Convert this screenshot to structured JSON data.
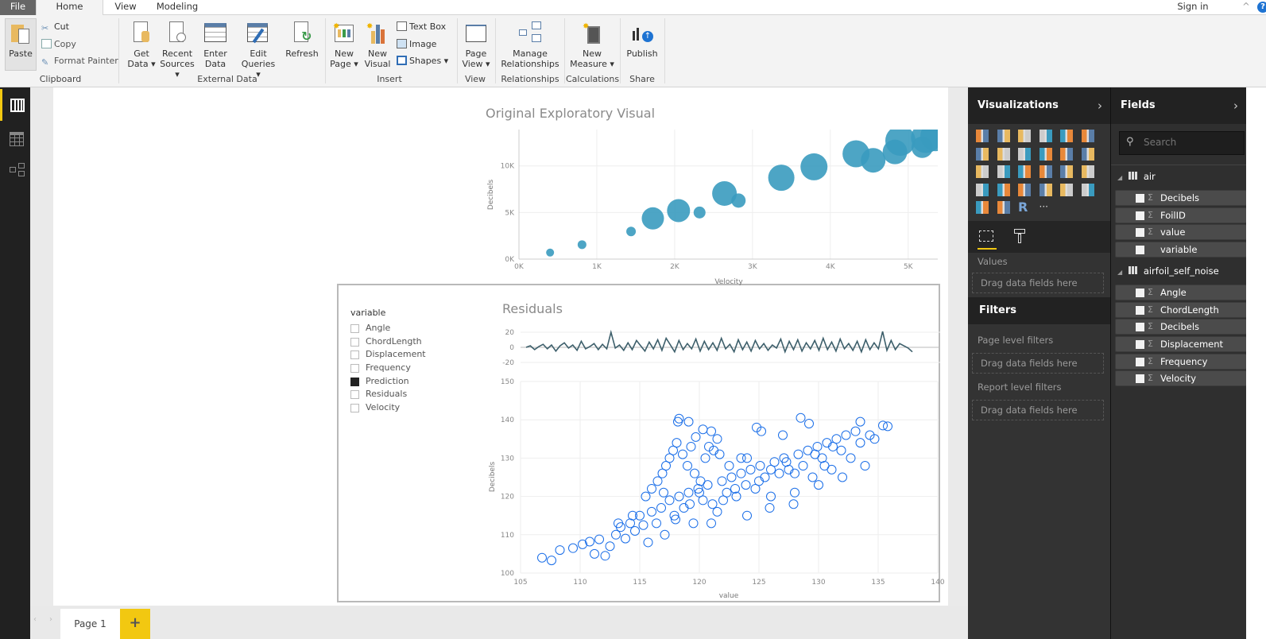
{
  "tabs": {
    "file": "File",
    "home": "Home",
    "view": "View",
    "modeling": "Modeling",
    "sign_in": "Sign in"
  },
  "ribbon": {
    "clipboard": {
      "paste": "Paste",
      "cut": "Cut",
      "copy": "Copy",
      "format_painter": "Format Painter",
      "group": "Clipboard"
    },
    "external_data": {
      "get_data": [
        "Get",
        "Data ▾"
      ],
      "recent_sources": [
        "Recent",
        "Sources ▾"
      ],
      "enter_data": [
        "Enter",
        "Data"
      ],
      "edit_queries": [
        "Edit",
        "Queries ▾"
      ],
      "refresh": "Refresh",
      "group": "External Data"
    },
    "insert": {
      "new_page": [
        "New",
        "Page ▾"
      ],
      "new_visual": [
        "New",
        "Visual"
      ],
      "text_box": "Text Box",
      "image": "Image",
      "shapes": "Shapes ▾",
      "group": "Insert"
    },
    "view": {
      "page_view": [
        "Page",
        "View ▾"
      ],
      "group": "View"
    },
    "relationships": {
      "manage": [
        "Manage",
        "Relationships"
      ],
      "group": "Relationships"
    },
    "calculations": {
      "new_measure": [
        "New",
        "Measure ▾"
      ],
      "group": "Calculations"
    },
    "share": {
      "publish": "Publish",
      "group": "Share"
    }
  },
  "leftnav": [
    "report-view-icon",
    "data-view-icon",
    "relationships-view-icon"
  ],
  "pages": {
    "tabs": [
      "Page 1"
    ],
    "add": "+"
  },
  "visualizations": {
    "title": "Visualizations",
    "icons": [
      "stacked-bar",
      "stacked-column",
      "clustered-bar",
      "clustered-column",
      "100-bar",
      "100-column",
      "line",
      "area",
      "stacked-area",
      "line-column",
      "line-clustered-column",
      "ribbon",
      "scatter",
      "pie",
      "treemap",
      "map",
      "table",
      "matrix",
      "filled-map",
      "funnel",
      "gauge",
      "multi-row-card",
      "card",
      "kpi",
      "slicer",
      "donut",
      "r-visual",
      "more"
    ],
    "values_label": "Values",
    "drop_hint": "Drag data fields here"
  },
  "filters": {
    "title": "Filters",
    "page_level": "Page level filters",
    "report_level": "Report level filters",
    "drop_hint": "Drag data fields here"
  },
  "fields": {
    "title": "Fields",
    "search_placeholder": "Search",
    "tables": [
      {
        "name": "air",
        "fields": [
          {
            "name": "Decibels",
            "sigma": true
          },
          {
            "name": "FoilID",
            "sigma": true
          },
          {
            "name": "value",
            "sigma": true
          },
          {
            "name": "variable",
            "sigma": false
          }
        ]
      },
      {
        "name": "airfoil_self_noise",
        "fields": [
          {
            "name": "Angle",
            "sigma": true
          },
          {
            "name": "ChordLength",
            "sigma": true
          },
          {
            "name": "Decibels",
            "sigma": true
          },
          {
            "name": "Displacement",
            "sigma": true
          },
          {
            "name": "Frequency",
            "sigma": true
          },
          {
            "name": "Velocity",
            "sigma": true
          }
        ]
      }
    ]
  },
  "slicer": {
    "title": "variable",
    "items": [
      {
        "label": "Angle",
        "checked": false
      },
      {
        "label": "ChordLength",
        "checked": false
      },
      {
        "label": "Displacement",
        "checked": false
      },
      {
        "label": "Frequency",
        "checked": false
      },
      {
        "label": "Prediction",
        "checked": true
      },
      {
        "label": "Residuals",
        "checked": false
      },
      {
        "label": "Velocity",
        "checked": false
      }
    ]
  },
  "chart_data": [
    {
      "type": "scatter",
      "title": "Original Exploratory Visual",
      "xlabel": "Velocity",
      "ylabel": "Decibels",
      "xlim": [
        0,
        5380
      ],
      "ylim": [
        0,
        13900
      ],
      "grid": true,
      "color": "#3a9bbf",
      "xticks": [
        "0K",
        "1K",
        "2K",
        "3K",
        "4K",
        "5K"
      ],
      "yticks": [
        "0K",
        "5K",
        "10K"
      ],
      "points": [
        {
          "x": 400,
          "y": 700,
          "size": 1
        },
        {
          "x": 810,
          "y": 1550,
          "size": 1.1
        },
        {
          "x": 1440,
          "y": 2960,
          "size": 1.2
        },
        {
          "x": 1720,
          "y": 4370,
          "size": 2.8
        },
        {
          "x": 2050,
          "y": 5200,
          "size": 2.9
        },
        {
          "x": 2320,
          "y": 5000,
          "size": 1.5
        },
        {
          "x": 2640,
          "y": 7040,
          "size": 3.1
        },
        {
          "x": 2820,
          "y": 6280,
          "size": 1.8
        },
        {
          "x": 3370,
          "y": 8730,
          "size": 3.3
        },
        {
          "x": 3790,
          "y": 9900,
          "size": 3.4
        },
        {
          "x": 4330,
          "y": 11300,
          "size": 3.4
        },
        {
          "x": 4550,
          "y": 10600,
          "size": 3.1
        },
        {
          "x": 4830,
          "y": 11500,
          "size": 3.1
        },
        {
          "x": 4900,
          "y": 12700,
          "size": 3.8
        },
        {
          "x": 5180,
          "y": 12000,
          "size": 2.7
        },
        {
          "x": 5230,
          "y": 13000,
          "size": 3.8
        },
        {
          "x": 5350,
          "y": 13200,
          "size": 3.8
        }
      ]
    },
    {
      "type": "line",
      "title": "Residuals",
      "ylim": [
        -20,
        20
      ],
      "yticks": [
        "20",
        "0",
        "-20"
      ],
      "color": "#3d5f6b",
      "values": [
        0,
        2,
        -3,
        1,
        4,
        -2,
        3,
        -5,
        2,
        6,
        -1,
        3,
        -4,
        8,
        -2,
        1,
        5,
        -3,
        4,
        -2,
        20,
        -1,
        3,
        -4,
        6,
        -3,
        9,
        2,
        -5,
        7,
        -2,
        10,
        -4,
        12,
        3,
        -6,
        9,
        -3,
        5,
        -2,
        11,
        -5,
        8,
        -3,
        6,
        -4,
        12,
        -2,
        4,
        -6,
        10,
        -3,
        7,
        -5,
        9,
        -2,
        5,
        -4,
        3,
        -1,
        11,
        -6,
        8,
        -3,
        10,
        -5,
        6,
        -2,
        9,
        -4,
        12,
        -3,
        7,
        -5,
        11,
        -2,
        5,
        -4,
        8,
        -6,
        10,
        -3,
        6,
        -2,
        21,
        -4,
        9,
        -3,
        5,
        2,
        -1,
        -6
      ]
    },
    {
      "type": "scatter",
      "xlabel": "value",
      "ylabel": "Decibels",
      "xlim": [
        105,
        140
      ],
      "ylim": [
        100,
        150
      ],
      "grid": true,
      "color": "#1a6ee8",
      "xticks": [
        "105",
        "110",
        "115",
        "120",
        "125",
        "130",
        "135",
        "140"
      ],
      "yticks": [
        "100",
        "110",
        "120",
        "130",
        "140",
        "150"
      ],
      "points": [
        [
          106.8,
          104
        ],
        [
          107.6,
          103.3
        ],
        [
          108.3,
          106
        ],
        [
          109.4,
          106.5
        ],
        [
          110.2,
          107.5
        ],
        [
          110.8,
          108.2
        ],
        [
          111.2,
          105
        ],
        [
          111.6,
          108.8
        ],
        [
          112.1,
          104.5
        ],
        [
          112.5,
          107
        ],
        [
          113,
          110
        ],
        [
          113.4,
          112
        ],
        [
          113.8,
          109
        ],
        [
          114.2,
          113
        ],
        [
          114.6,
          111
        ],
        [
          115,
          115
        ],
        [
          115.3,
          112.5
        ],
        [
          115.7,
          108
        ],
        [
          116,
          116
        ],
        [
          116.4,
          113
        ],
        [
          116.8,
          117
        ],
        [
          117.1,
          110
        ],
        [
          117.5,
          119
        ],
        [
          117.9,
          115
        ],
        [
          118.3,
          120
        ],
        [
          118.7,
          117
        ],
        [
          119.1,
          121
        ],
        [
          119.5,
          113
        ],
        [
          119.9,
          122
        ],
        [
          120.3,
          119
        ],
        [
          120.7,
          123
        ],
        [
          121.1,
          118
        ],
        [
          121.5,
          116
        ],
        [
          121.9,
          124
        ],
        [
          122.3,
          121
        ],
        [
          122.7,
          125
        ],
        [
          123.1,
          120
        ],
        [
          123.5,
          126
        ],
        [
          123.9,
          123
        ],
        [
          124.3,
          127
        ],
        [
          124.7,
          122
        ],
        [
          125.1,
          128
        ],
        [
          125.5,
          125
        ],
        [
          125.9,
          117
        ],
        [
          126.3,
          129
        ],
        [
          126.7,
          126
        ],
        [
          127.1,
          130
        ],
        [
          127.5,
          127
        ],
        [
          127.9,
          118
        ],
        [
          128.3,
          131
        ],
        [
          128.7,
          128
        ],
        [
          129.1,
          132
        ],
        [
          129.5,
          125
        ],
        [
          129.9,
          133
        ],
        [
          130.3,
          130
        ],
        [
          130.7,
          134
        ],
        [
          131.1,
          127
        ],
        [
          131.5,
          135
        ],
        [
          131.9,
          132
        ],
        [
          132.3,
          136
        ],
        [
          132.7,
          130
        ],
        [
          133.1,
          137
        ],
        [
          133.5,
          134
        ],
        [
          133.9,
          128
        ],
        [
          134.3,
          136
        ],
        [
          134.7,
          135
        ],
        [
          135.4,
          138.5
        ],
        [
          135.8,
          138.3
        ],
        [
          121,
          113
        ],
        [
          124,
          115
        ],
        [
          126,
          120
        ],
        [
          128,
          121
        ],
        [
          130,
          123
        ],
        [
          132,
          125
        ],
        [
          133.5,
          139.5
        ],
        [
          122.5,
          128
        ],
        [
          124.8,
          138
        ],
        [
          125.2,
          137
        ],
        [
          127,
          136
        ],
        [
          128.5,
          140.5
        ],
        [
          129.2,
          139
        ],
        [
          123.5,
          130
        ],
        [
          124,
          130
        ],
        [
          115.5,
          120
        ],
        [
          116,
          122
        ],
        [
          116.5,
          124
        ],
        [
          116.9,
          126
        ],
        [
          117.2,
          128
        ],
        [
          117.5,
          130
        ],
        [
          117.8,
          132
        ],
        [
          118.1,
          134
        ],
        [
          118.2,
          139.5
        ],
        [
          118.3,
          140.3
        ],
        [
          119.1,
          139.5
        ],
        [
          118.6,
          131
        ],
        [
          119,
          128
        ],
        [
          119.3,
          133
        ],
        [
          119.7,
          135.5
        ],
        [
          120.3,
          137.5
        ],
        [
          121,
          137
        ],
        [
          120.8,
          133
        ],
        [
          121.2,
          132
        ],
        [
          120.5,
          130
        ],
        [
          119.6,
          126
        ],
        [
          120.1,
          124
        ],
        [
          121.5,
          135
        ],
        [
          121.7,
          131
        ],
        [
          113.2,
          113
        ],
        [
          114.4,
          115
        ],
        [
          117,
          121
        ],
        [
          119.2,
          118
        ],
        [
          122,
          119
        ],
        [
          125,
          124
        ],
        [
          127.3,
          129
        ],
        [
          129.7,
          131
        ],
        [
          131.2,
          133
        ],
        [
          126,
          127
        ],
        [
          128,
          126
        ],
        [
          130.5,
          128
        ],
        [
          123,
          122
        ],
        [
          120,
          121
        ],
        [
          118,
          114
        ]
      ]
    }
  ]
}
